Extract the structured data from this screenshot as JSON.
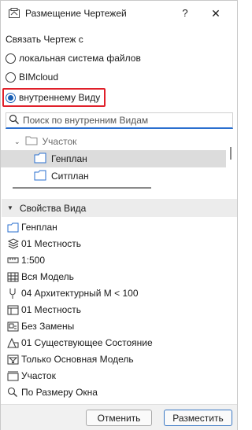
{
  "window": {
    "title": "Размещение Чертежей",
    "help_label": "?",
    "close_label": "✕"
  },
  "link": {
    "label": "Связать Чертеж с",
    "options": [
      {
        "label": "локальная система файлов",
        "checked": false
      },
      {
        "label": "BIMcloud",
        "checked": false
      },
      {
        "label": "внутреннему Виду",
        "checked": true
      }
    ]
  },
  "search": {
    "placeholder": "Поиск по внутренним Видам",
    "value": ""
  },
  "tree": {
    "items": [
      {
        "label": "Участок",
        "type": "folder",
        "selected": false
      },
      {
        "label": "Генплан",
        "type": "view",
        "selected": true
      },
      {
        "label": "Ситплан",
        "type": "view",
        "selected": false
      }
    ]
  },
  "properties": {
    "header": "Свойства Вида",
    "rows": [
      {
        "icon": "view-icon",
        "value": "Генплан"
      },
      {
        "icon": "layers-icon",
        "value": "01 Местность"
      },
      {
        "icon": "scale-icon",
        "value": "1:500"
      },
      {
        "icon": "structure-icon",
        "value": "Вся Модель"
      },
      {
        "icon": "pen-icon",
        "value": "04 Архитектурный М < 100"
      },
      {
        "icon": "model-view-icon",
        "value": "01 Местность"
      },
      {
        "icon": "graphic-override-icon",
        "value": "Без Замены"
      },
      {
        "icon": "renovation-icon",
        "value": "01 Существующее Состояние"
      },
      {
        "icon": "filter-icon",
        "value": "Только Основная Модель"
      },
      {
        "icon": "dimension-icon",
        "value": "Участок"
      },
      {
        "icon": "zoom-icon",
        "value": "По Размеру Окна"
      }
    ]
  },
  "buttons": {
    "cancel": "Отменить",
    "place": "Разместить"
  },
  "colors": {
    "accent": "#1a5fb4",
    "highlight": "#e0202a",
    "selected_row": "#dcdcdc"
  }
}
